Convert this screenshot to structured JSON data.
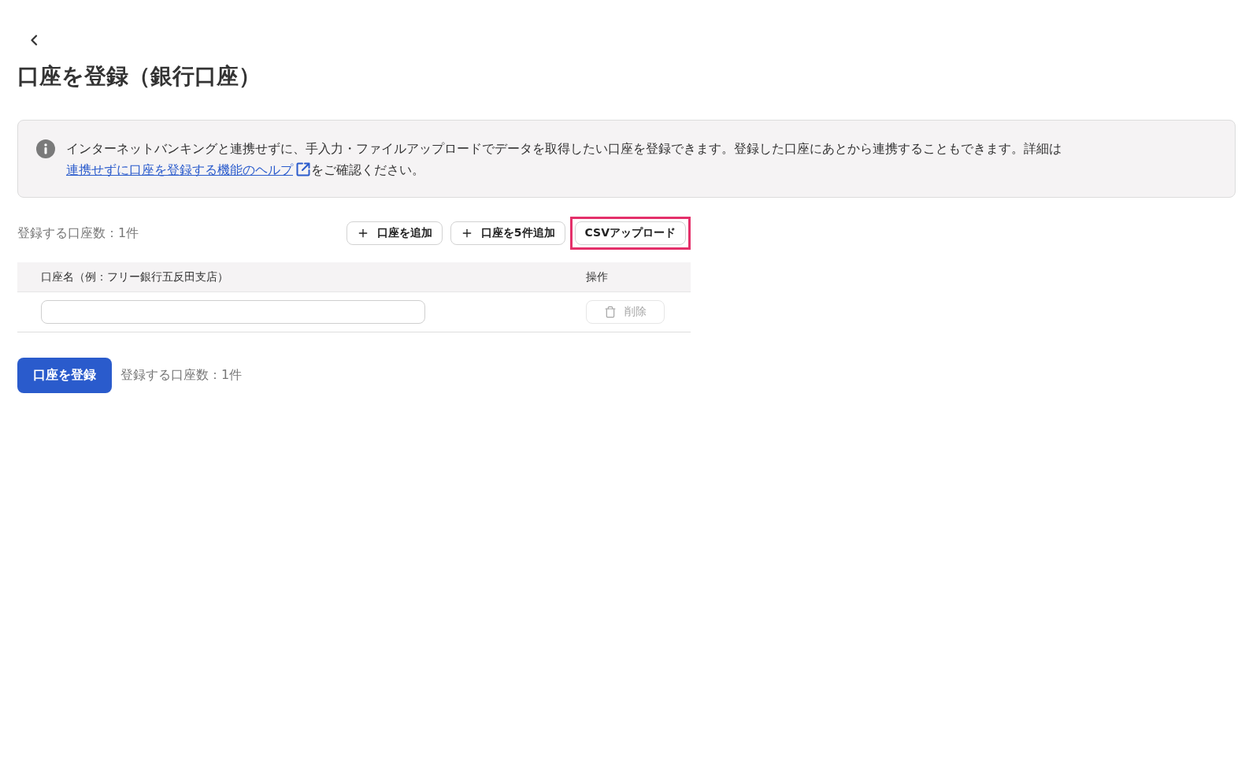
{
  "page": {
    "title": "口座を登録（銀行口座）"
  },
  "notice": {
    "text": "インターネットバンキングと連携せずに、手入力・ファイルアップロードでデータを取得したい口座を登録できます。登録した口座にあとから連携することもできます。詳細は",
    "link": "連携せずに口座を登録する機能のヘルプ",
    "text_after": "をご確認ください。"
  },
  "toolbar": {
    "count_label": "登録する口座数：1件",
    "buttons": [
      {
        "kind": "add",
        "label": "口座を追加",
        "highlighted": false
      },
      {
        "kind": "add",
        "label": "口座を5件追加",
        "highlighted": false
      },
      {
        "kind": "upload",
        "label": "CSVアップロード",
        "highlighted": true
      }
    ]
  },
  "table": {
    "columns": [
      "口座名（例：フリー銀行五反田支店）",
      "操作"
    ],
    "rows": [
      {
        "delete_label": "削除",
        "delete_disabled": true
      }
    ]
  },
  "footer": {
    "submit_label": "口座を登録",
    "count_label": "登録する口座数：1件"
  }
}
